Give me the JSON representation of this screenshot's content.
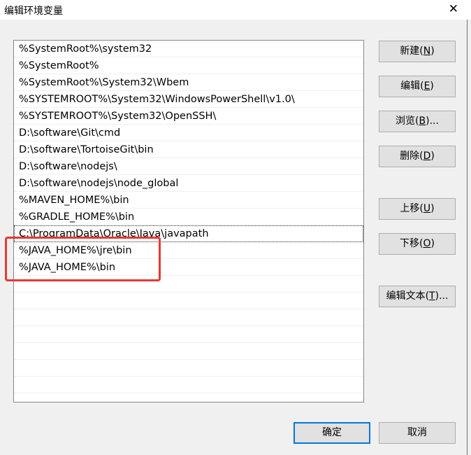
{
  "window": {
    "title": "编辑环境变量",
    "close_glyph": "✕"
  },
  "path_list": {
    "items": [
      "%SystemRoot%\\system32",
      "%SystemRoot%",
      "%SystemRoot%\\System32\\Wbem",
      "%SYSTEMROOT%\\System32\\WindowsPowerShell\\v1.0\\",
      "%SYSTEMROOT%\\System32\\OpenSSH\\",
      "D:\\software\\Git\\cmd",
      "D:\\software\\TortoiseGit\\bin",
      "D:\\software\\nodejs\\",
      "D:\\software\\nodejs\\node_global",
      "%MAVEN_HOME%\\bin",
      "%GRADLE_HOME%\\bin",
      "C:\\ProgramData\\Oracle\\Java\\javapath",
      "%JAVA_HOME%\\jre\\bin",
      "%JAVA_HOME%\\bin",
      "",
      "",
      "",
      "",
      "",
      "",
      "",
      ""
    ],
    "selected_index": 11
  },
  "buttons": {
    "new": {
      "text": "新建(",
      "key": "N",
      "end": ")"
    },
    "edit": {
      "text": "编辑(",
      "key": "E",
      "end": ")"
    },
    "browse": {
      "text": "浏览(",
      "key": "B",
      "end": ")..."
    },
    "delete": {
      "text": "删除(",
      "key": "D",
      "end": ")"
    },
    "move_up": {
      "text": "上移(",
      "key": "U",
      "end": ")"
    },
    "move_down": {
      "text": "下移(",
      "key": "O",
      "end": ")"
    },
    "edit_text": {
      "text": "编辑文本(",
      "key": "T",
      "end": ")..."
    },
    "ok": "确定",
    "cancel": "取消"
  },
  "colors": {
    "highlight": "#e53935",
    "focus": "#0078d7"
  }
}
